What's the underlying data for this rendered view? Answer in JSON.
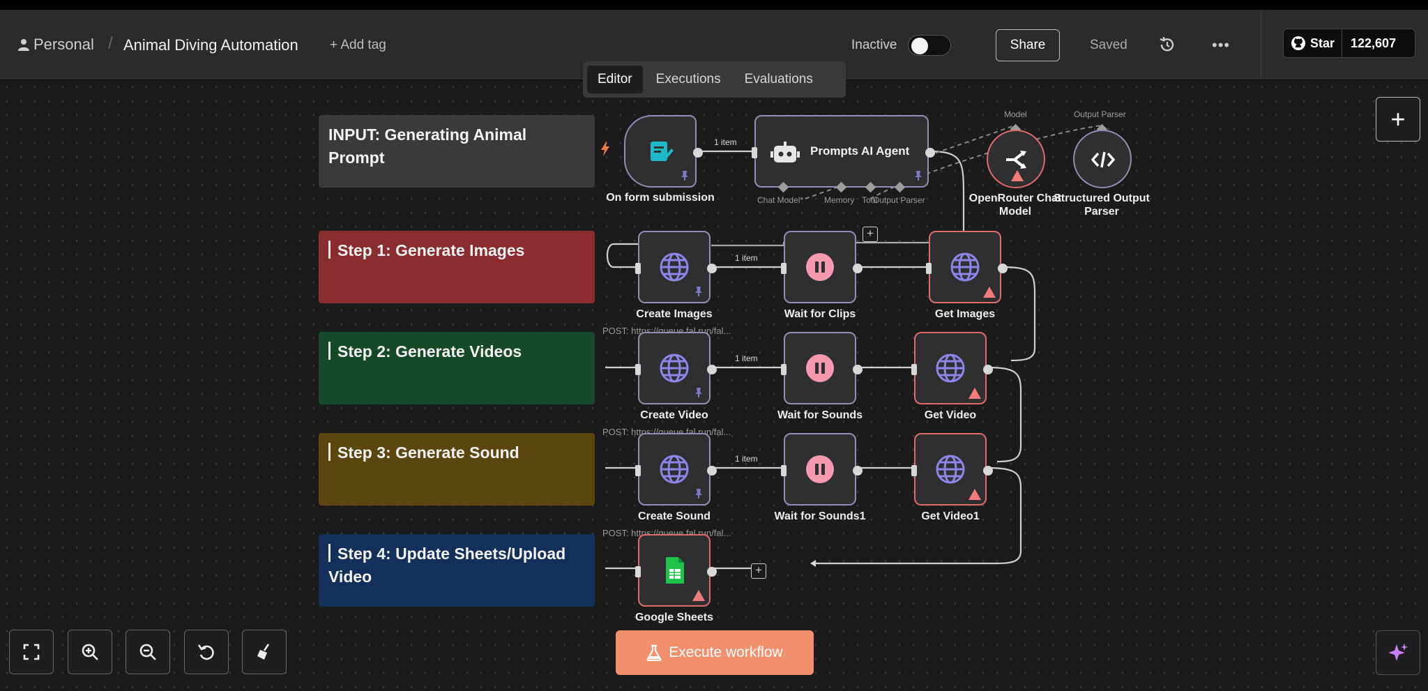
{
  "header": {
    "project": "Personal",
    "workflow_title": "Animal Diving Automation",
    "add_tag": "+ Add tag",
    "status_label": "Inactive",
    "share_label": "Share",
    "saved_label": "Saved",
    "more_label": "•••",
    "github_star": "Star",
    "github_count": "122,607"
  },
  "tabs": [
    {
      "label": "Editor",
      "active": true
    },
    {
      "label": "Executions",
      "active": false
    },
    {
      "label": "Evaluations",
      "active": false
    }
  ],
  "stickies": {
    "input": "INPUT: Generating Animal Prompt",
    "step1": "Step 1: Generate Images",
    "step2": "Step 2: Generate Videos",
    "step3": "Step 3: Generate Sound",
    "step4": "Step 4: Update Sheets/Upload Video"
  },
  "colors": {
    "input": "#3a3a3c",
    "step1": "#8a2b2e",
    "step2": "#16492a",
    "step3": "#5c4610",
    "step4": "#13305a",
    "execute": "#f2906e",
    "node_border": "#8f8fb8",
    "warn_border": "#e06b6b"
  },
  "nodes": {
    "form": "On form submission",
    "agent": "Prompts AI Agent",
    "agent_ports": {
      "chat_model": "Chat Model*",
      "memory": "Memory",
      "tool": "Tool",
      "output_parser": "Output Parser"
    },
    "openrouter": "OpenRouter Chat Model",
    "openrouter_port": "Model",
    "parser": "Structured Output Parser",
    "parser_port": "Output Parser",
    "create_images": "Create Images",
    "wait_clips": "Wait for Clips",
    "get_images": "Get Images",
    "create_video": "Create Video",
    "wait_sounds": "Wait for Sounds",
    "get_video": "Get Video",
    "create_sound": "Create Sound",
    "wait_sounds1": "Wait for Sounds1",
    "get_video1": "Get Video1",
    "google_sheets": "Google Sheets",
    "post_url": "POST: https://queue.fal.run/fal...",
    "item_label": "1 item"
  },
  "buttons": {
    "execute": "Execute workflow",
    "add_node": "+"
  }
}
